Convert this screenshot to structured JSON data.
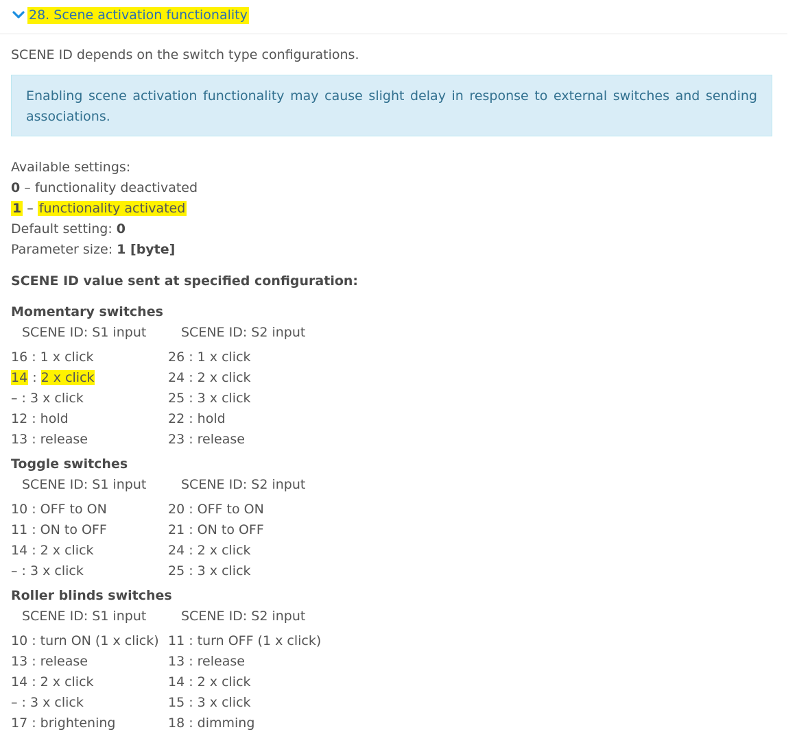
{
  "header": {
    "icon": "chevron-down-icon",
    "title": "28. Scene activation functionality",
    "highlight_color": "#fff200",
    "title_color": "#2b6fb0"
  },
  "intro": "SCENE ID depends on the switch type configurations.",
  "alert": "Enabling scene activation functionality may cause slight delay in response to external switches and sending associations.",
  "settings": {
    "available_label": "Available settings:",
    "opt0_value": "0",
    "opt0_sep": " – ",
    "opt0_text": "functionality deactivated",
    "opt1_value": "1",
    "opt1_sep": " – ",
    "opt1_text": "functionality activated",
    "default_label": "Default setting: ",
    "default_value": "0",
    "size_label": "Parameter size: ",
    "size_value": "1 [byte]"
  },
  "scene_heading": "SCENE ID value sent at specified configuration:",
  "col_s1": "SCENE ID: S1 input",
  "col_s2": "SCENE ID: S2 input",
  "sections": [
    {
      "title": "Momentary switches",
      "rows": [
        [
          "16 : 1 x click",
          "26 : 1 x click"
        ],
        [
          "14 : 2 x click",
          "24 : 2 x click"
        ],
        [
          "–  : 3 x click",
          "25 : 3 x click"
        ],
        [
          "12 : hold",
          "22 : hold"
        ],
        [
          "13 : release",
          "23 : release"
        ]
      ]
    },
    {
      "title": "Toggle switches",
      "rows": [
        [
          "10 : OFF to ON",
          "20 : OFF to ON"
        ],
        [
          "11 : ON to OFF",
          "21 : ON to OFF"
        ],
        [
          "14 : 2 x click",
          "24 : 2 x click"
        ],
        [
          "–  : 3 x click",
          "25 : 3 x click"
        ]
      ]
    },
    {
      "title": "Roller blinds switches",
      "rows": [
        [
          "10 : turn ON (1 x click)",
          "11 : turn OFF (1 x click)"
        ],
        [
          "13 : release",
          "13 : release"
        ],
        [
          "14 : 2 x click",
          "14 : 2 x click"
        ],
        [
          "–  : 3 x click",
          "15 : 3 x click"
        ],
        [
          "17 : brightening",
          "18 : dimming"
        ]
      ]
    }
  ],
  "highlight_cell_m1": {
    "id": "14",
    "sep": " : ",
    "text": "2 x click"
  }
}
